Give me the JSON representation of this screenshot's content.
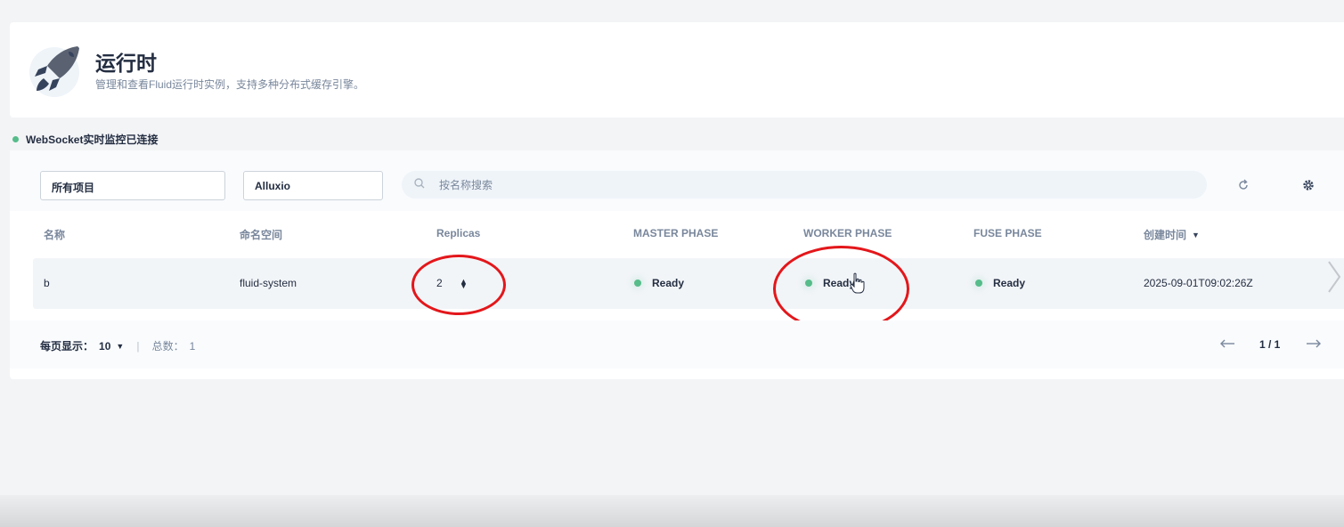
{
  "header": {
    "title": "运行时",
    "description": "管理和查看Fluid运行时实例，支持多种分布式缓存引擎。",
    "logo_icon": "rocket-icon"
  },
  "ws_status": {
    "text": "WebSocket实时监控已连接",
    "color": "#55bc8a"
  },
  "toolbar": {
    "project_select": "所有项目",
    "runtime_select": "Alluxio",
    "search_placeholder": "按名称搜索",
    "refresh_icon": "refresh-icon",
    "settings_icon": "gear-icon"
  },
  "table": {
    "columns": [
      "名称",
      "命名空间",
      "Replicas",
      "MASTER PHASE",
      "WORKER PHASE",
      "FUSE PHASE",
      "创建时间"
    ],
    "rows": [
      {
        "name": "b",
        "namespace": "fluid-system",
        "replicas": "2",
        "master_phase": "Ready",
        "worker_phase": "Ready",
        "fuse_phase": "Ready",
        "created": "2025-09-01T09:02:26Z"
      }
    ]
  },
  "pagination": {
    "page_size_label": "每页显示：",
    "page_size": "10",
    "total_label": "总数：",
    "total": "1",
    "page": "1 / 1"
  },
  "annotation_color": "#e3171b"
}
